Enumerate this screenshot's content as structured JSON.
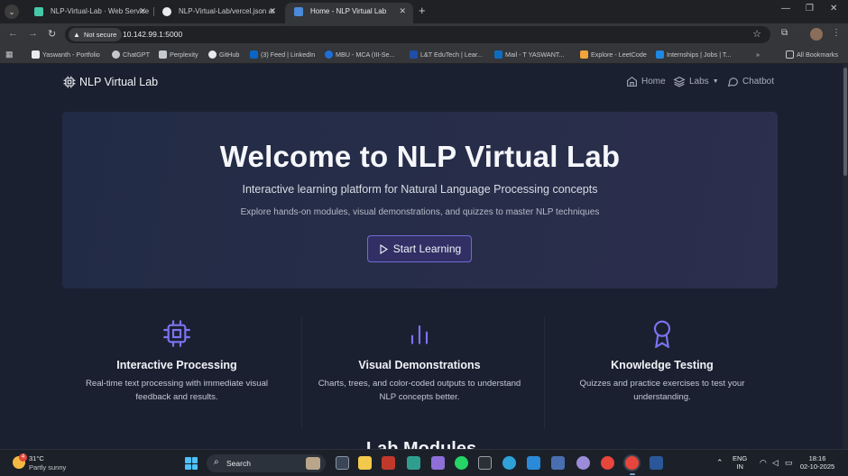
{
  "browser": {
    "tabs": [
      {
        "title": "NLP-Virtual-Lab · Web Service",
        "favicon_color": "#46c8a8",
        "active": false
      },
      {
        "title": "NLP-Virtual-Lab/vercel.json at",
        "favicon_color": "#e8eaed",
        "active": false
      },
      {
        "title": "Home - NLP Virtual Lab",
        "favicon_color": "#4a8ad8",
        "active": true
      }
    ],
    "new_tab": "+",
    "security_label": "Not secure",
    "url": "10.142.99.1:5000",
    "bookmarks": [
      {
        "label": "Yaswanth - Portfolio",
        "color": "#e8eaed"
      },
      {
        "label": "ChatGPT",
        "color": "#c5c8cc"
      },
      {
        "label": "Perplexity",
        "color": "#c5c8cc"
      },
      {
        "label": "GitHub",
        "color": "#e8eaed"
      },
      {
        "label": "(3) Feed | LinkedIn",
        "color": "#0a66c2"
      },
      {
        "label": "MBU - MCA (III-Se...",
        "color": "#1e6fd9"
      },
      {
        "label": "L&T EduTech | Lear...",
        "color": "#1f4ea8"
      },
      {
        "label": "Mail - T YASWANT...",
        "color": "#0f6cbd"
      },
      {
        "label": "Explore - LeetCode",
        "color": "#f0a43a"
      },
      {
        "label": "Internships | Jobs | T...",
        "color": "#1e88e5"
      }
    ],
    "bookmarks_overflow": "»",
    "all_bookmarks": "All Bookmarks"
  },
  "site": {
    "brand": "NLP Virtual Lab",
    "nav": {
      "home": "Home",
      "labs": "Labs",
      "chatbot": "Chatbot"
    },
    "hero": {
      "title": "Welcome to NLP Virtual Lab",
      "subtitle": "Interactive learning platform for Natural Language Processing concepts",
      "description": "Explore hands-on modules, visual demonstrations, and quizzes to master NLP techniques",
      "cta": "Start Learning"
    },
    "features": [
      {
        "icon": "cpu-icon",
        "title": "Interactive Processing",
        "desc": "Real-time text processing with immediate visual feedback and results."
      },
      {
        "icon": "bar-chart-icon",
        "title": "Visual Demonstrations",
        "desc": "Charts, trees, and color-coded outputs to understand NLP concepts better."
      },
      {
        "icon": "award-icon",
        "title": "Knowledge Testing",
        "desc": "Quizzes and practice exercises to test your understanding."
      }
    ],
    "section_title": "Lab Modules",
    "accent_color": "#7b74f2"
  },
  "taskbar": {
    "weather_badge": "4",
    "temperature": "31°C",
    "condition": "Partly sunny",
    "search": "Search",
    "language": "ENG",
    "region": "IN",
    "time": "18:16",
    "date": "02-10-2025"
  }
}
